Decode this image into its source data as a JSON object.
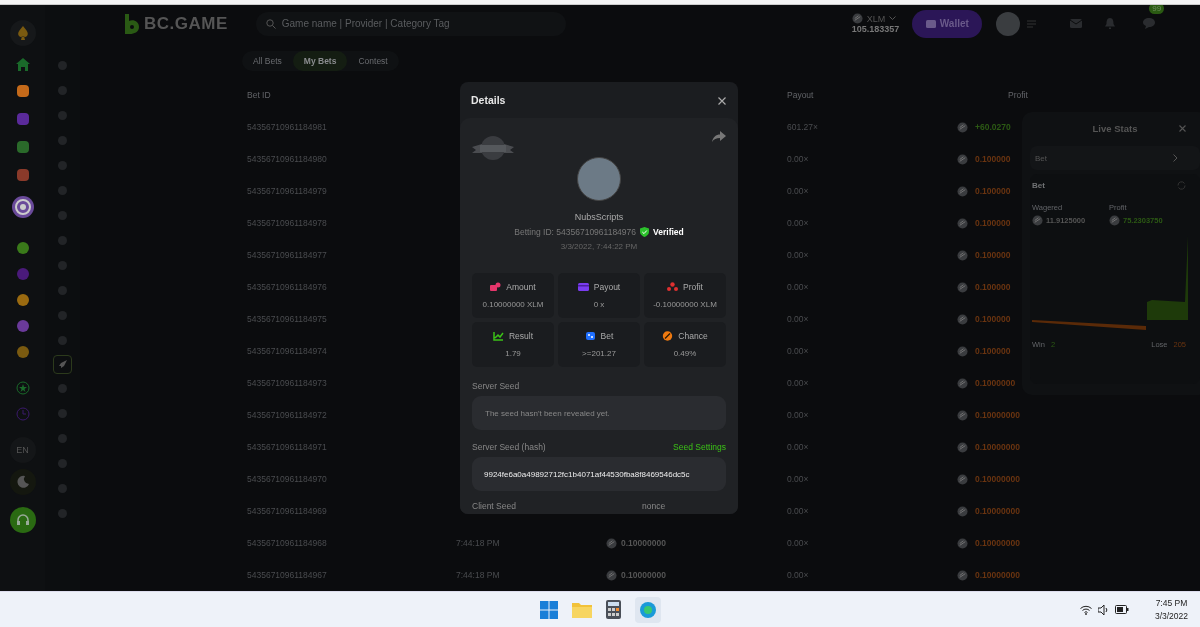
{
  "header": {
    "logo": "BC.GAME",
    "search": {
      "placeholder": "Game name | Provider | Category Tag"
    },
    "currency": "XLM",
    "balance": "105.183357",
    "wallet_button": "Wallet",
    "chat_badge": "99"
  },
  "sidebar": {
    "language": "EN"
  },
  "tabs": [
    {
      "label": "All Bets",
      "selected": false
    },
    {
      "label": "My Bets",
      "selected": true
    },
    {
      "label": "Contest",
      "selected": false
    }
  ],
  "table": {
    "columns": [
      "Bet ID",
      "Payout",
      "Profit"
    ],
    "rows": [
      {
        "bet_id": "54356710961184981",
        "payout": "601.27×",
        "profit": "+60.0270",
        "win": true
      },
      {
        "bet_id": "54356710961184980",
        "payout": "0.00×",
        "profit": "0.100000",
        "win": false
      },
      {
        "bet_id": "54356710961184979",
        "payout": "0.00×",
        "profit": "0.100000",
        "win": false
      },
      {
        "bet_id": "54356710961184978",
        "payout": "0.00×",
        "profit": "0.100000",
        "win": false
      },
      {
        "bet_id": "54356710961184977",
        "payout": "0.00×",
        "profit": "0.100000",
        "win": false
      },
      {
        "bet_id": "54356710961184976",
        "payout": "0.00×",
        "profit": "0.100000",
        "win": false
      },
      {
        "bet_id": "54356710961184975",
        "payout": "0.00×",
        "profit": "0.100000",
        "win": false
      },
      {
        "bet_id": "54356710961184974",
        "payout": "0.00×",
        "profit": "0.100000",
        "win": false
      },
      {
        "bet_id": "54356710961184973",
        "payout": "0.00×",
        "profit": "0.1000000",
        "win": false
      },
      {
        "bet_id": "54356710961184972",
        "payout": "0.00×",
        "profit": "0.10000000",
        "win": false
      },
      {
        "bet_id": "54356710961184971",
        "payout": "0.00×",
        "profit": "0.10000000",
        "win": false
      },
      {
        "bet_id": "54356710961184970",
        "payout": "0.00×",
        "profit": "0.10000000",
        "win": false
      },
      {
        "bet_id": "54356710961184969",
        "payout": "0.00×",
        "profit": "0.10000000",
        "win": false
      },
      {
        "bet_id": "54356710961184968",
        "time": "7:44:18 PM",
        "amount": "0.10000000",
        "payout": "0.00×",
        "profit": "0.10000000",
        "win": false
      },
      {
        "bet_id": "54356710961184967",
        "time": "7:44:18 PM",
        "amount": "0.10000000",
        "payout": "0.00×",
        "profit": "0.10000000",
        "win": false
      }
    ]
  },
  "details": {
    "title": "Details",
    "user": "NubsScripts",
    "betting_id": "Betting ID: 54356710961184976",
    "verified": "Verified",
    "date": "3/3/2022, 7:44:22 PM",
    "stats": [
      {
        "kind": "amount",
        "label": "Amount",
        "value": "0.10000000 XLM"
      },
      {
        "kind": "payout",
        "label": "Payout",
        "value": "0 x"
      },
      {
        "kind": "profit",
        "label": "Profit",
        "value": "-0.10000000 XLM"
      },
      {
        "kind": "result",
        "label": "Result",
        "value": "1.79"
      },
      {
        "kind": "bet",
        "label": "Bet",
        "value": ">=201.27"
      },
      {
        "kind": "chance",
        "label": "Chance",
        "value": "0.49%"
      }
    ],
    "server_seed_label": "Server Seed",
    "server_seed": "The seed hasn't been revealed yet.",
    "hash_label": "Server Seed (hash)",
    "seed_settings_link": "Seed Settings",
    "hash": "9924fe6a0a49892712fc1b4071af44530fba8f8469546dc5c",
    "client_seed_label": "Client Seed",
    "nonce_label": "nonce"
  },
  "live_stats": {
    "title": "Live Stats",
    "dropdown": "Bet",
    "card_title": "Bet",
    "wagered_label": "Wagered",
    "wagered": "11.9125000",
    "profit_label": "Profit",
    "profit": "75.2303750",
    "win_label": "Win",
    "win": "2",
    "lose_label": "Lose",
    "lose": "205"
  },
  "taskbar": {
    "time": "7:45 PM",
    "date": "3/3/2022"
  }
}
